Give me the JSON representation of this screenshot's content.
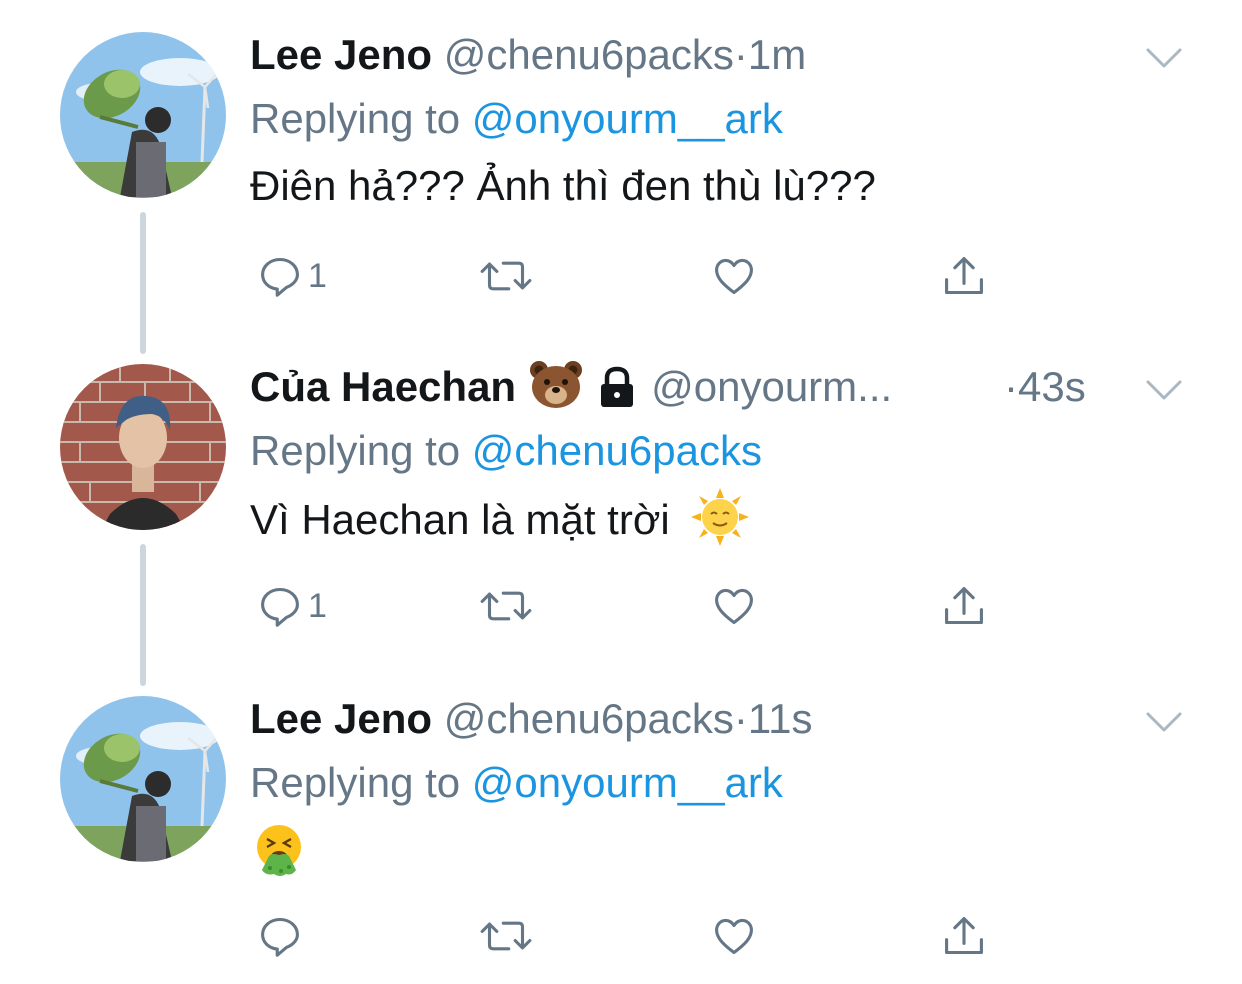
{
  "tweets": [
    {
      "name": "Lee Jeno",
      "handle": "@chenu6packs",
      "separator": "·",
      "time": "1m",
      "replying_prefix": "Replying to",
      "replying_to": "@onyourm__ark",
      "text": "Điên hả??? Ảnh thì đen thù lù???",
      "reply_count": "1",
      "avatar": "avatar-with-flowers",
      "icons": [
        "reply-icon",
        "retweet-icon",
        "like-icon",
        "share-icon",
        "chevron-down-icon"
      ]
    },
    {
      "name": "Của Haechan",
      "handle": "@onyourm...",
      "separator": "·",
      "time": "43s",
      "replying_prefix": "Replying to",
      "replying_to": "@chenu6packs",
      "text": "Vì Haechan là mặt trời",
      "reply_count": "1",
      "avatar": "avatar-brick-wall",
      "name_emoji": "bear-face-emoji",
      "protected_icon": "lock-icon",
      "text_emoji": "sun-with-face-emoji",
      "icons": [
        "reply-icon",
        "retweet-icon",
        "like-icon",
        "share-icon",
        "chevron-down-icon"
      ]
    },
    {
      "name": "Lee Jeno",
      "handle": "@chenu6packs",
      "separator": "·",
      "time": "11s",
      "replying_prefix": "Replying to",
      "replying_to": "@onyourm__ark",
      "text": "",
      "reply_count": "",
      "avatar": "avatar-with-flowers",
      "text_emoji": "vomiting-face-emoji",
      "icons": [
        "reply-icon",
        "retweet-icon",
        "like-icon",
        "share-icon",
        "chevron-down-icon"
      ]
    }
  ],
  "colors": {
    "primary_text": "#14171a",
    "secondary_text": "#657786",
    "link": "#1b95e0",
    "thread_line": "#ccd6dd"
  }
}
